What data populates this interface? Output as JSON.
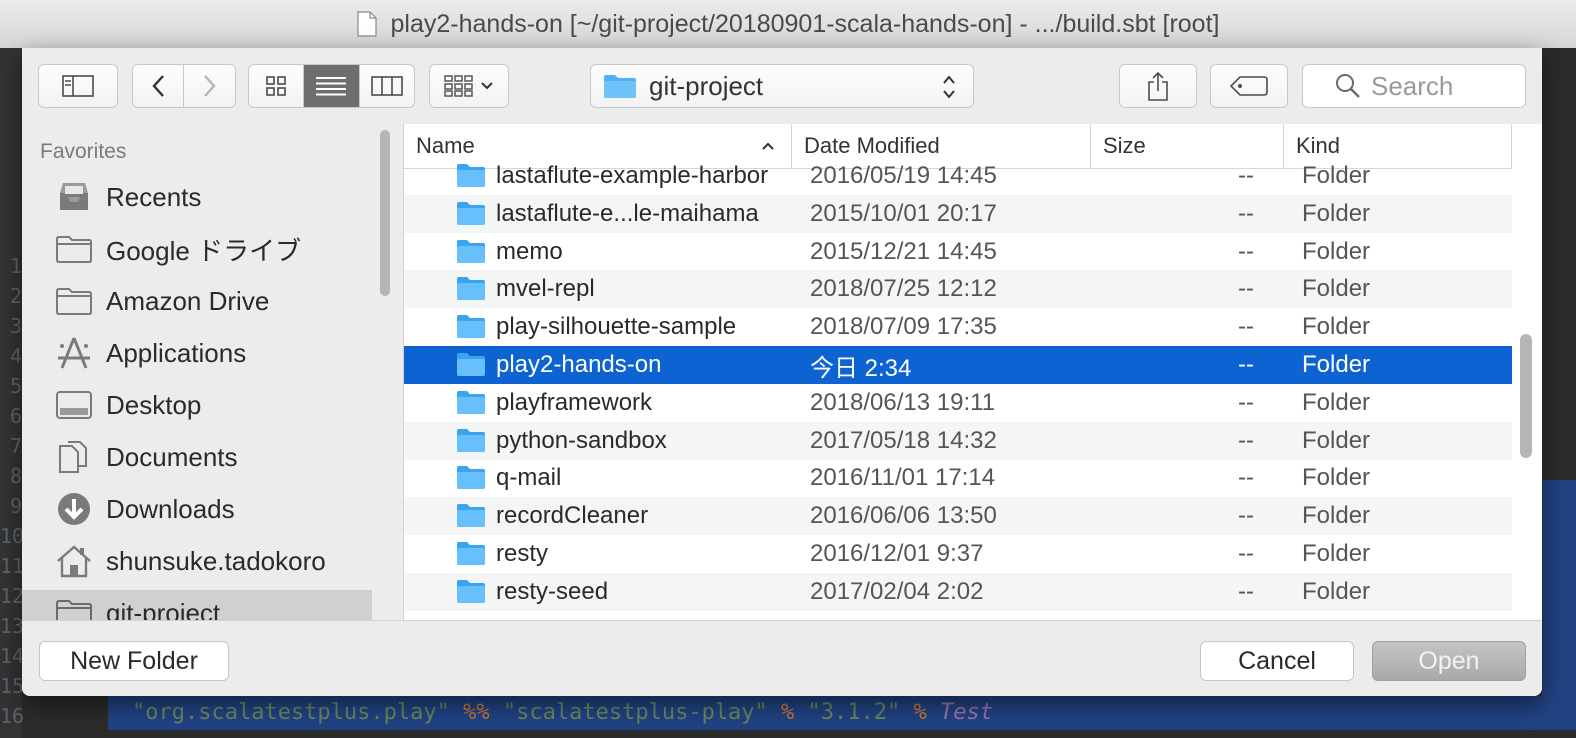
{
  "window": {
    "title": "play2-hands-on [~/git-project/20180901-scala-hands-on] - .../build.sbt [root]"
  },
  "editor": {
    "line_numbers": [
      "1",
      "2",
      "3",
      "4",
      "5",
      "6",
      "7",
      "8",
      "9",
      "10",
      "11",
      "12",
      "13",
      "14",
      "15",
      "16"
    ],
    "code_line": {
      "s1": "\"org.scalatestplus.play\"",
      "op1": "%%",
      "s2": "\"scalatestplus-play\"",
      "op2": "%",
      "s3": "\"3.1.2\"",
      "op3": "%",
      "kw": "Test"
    }
  },
  "toolbar": {
    "path_label": "git-project",
    "search_placeholder": "Search"
  },
  "sidebar": {
    "heading": "Favorites",
    "items": [
      {
        "label": "Recents",
        "icon": "recents-icon"
      },
      {
        "label": "Google ドライブ",
        "icon": "folder-icon"
      },
      {
        "label": "Amazon Drive",
        "icon": "folder-icon"
      },
      {
        "label": "Applications",
        "icon": "applications-icon"
      },
      {
        "label": "Desktop",
        "icon": "desktop-icon"
      },
      {
        "label": "Documents",
        "icon": "documents-icon"
      },
      {
        "label": "Downloads",
        "icon": "downloads-icon"
      },
      {
        "label": "shunsuke.tadokoro",
        "icon": "home-icon"
      },
      {
        "label": "git-project",
        "icon": "folder-icon"
      }
    ]
  },
  "columns": {
    "name": "Name",
    "date": "Date Modified",
    "size": "Size",
    "kind": "Kind"
  },
  "files": [
    {
      "name": "lastaflute-example-harbor",
      "date": "2016/05/19 14:45",
      "size": "--",
      "kind": "Folder"
    },
    {
      "name": "lastaflute-e...le-maihama",
      "date": "2015/10/01 20:17",
      "size": "--",
      "kind": "Folder"
    },
    {
      "name": "memo",
      "date": "2015/12/21 14:45",
      "size": "--",
      "kind": "Folder"
    },
    {
      "name": "mvel-repl",
      "date": "2018/07/25 12:12",
      "size": "--",
      "kind": "Folder"
    },
    {
      "name": "play-silhouette-sample",
      "date": "2018/07/09 17:35",
      "size": "--",
      "kind": "Folder"
    },
    {
      "name": "play2-hands-on",
      "date": "今日 2:34",
      "size": "--",
      "kind": "Folder"
    },
    {
      "name": "playframework",
      "date": "2018/06/13 19:11",
      "size": "--",
      "kind": "Folder"
    },
    {
      "name": "python-sandbox",
      "date": "2017/05/18 14:32",
      "size": "--",
      "kind": "Folder"
    },
    {
      "name": "q-mail",
      "date": "2016/11/01 17:14",
      "size": "--",
      "kind": "Folder"
    },
    {
      "name": "recordCleaner",
      "date": "2016/06/06 13:50",
      "size": "--",
      "kind": "Folder"
    },
    {
      "name": "resty",
      "date": "2016/12/01 9:37",
      "size": "--",
      "kind": "Folder"
    },
    {
      "name": "resty-seed",
      "date": "2017/02/04 2:02",
      "size": "--",
      "kind": "Folder"
    }
  ],
  "selected_file": "play2-hands-on",
  "buttons": {
    "new_folder": "New Folder",
    "cancel": "Cancel",
    "open": "Open"
  }
}
